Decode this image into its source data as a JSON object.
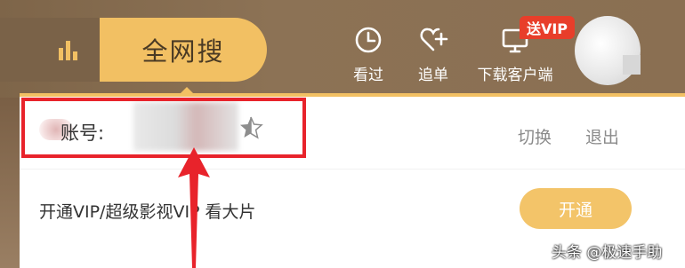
{
  "search": {
    "label": "全网搜"
  },
  "nav": {
    "history": "看过",
    "watchlist": "追单",
    "download": "下载客户端",
    "vip_badge": "送VIP"
  },
  "account": {
    "label": "账号:",
    "switch": "切换",
    "logout": "退出"
  },
  "promo": {
    "text": "开通VIP/超级影视VIP 看大片",
    "button": "开通"
  },
  "watermark": "头条 @极速手助",
  "colors": {
    "accent": "#f2c063",
    "highlight_box": "#e8232b",
    "vip_badge": "#e83e2a",
    "link_gray": "#8b8b8b"
  },
  "icons": [
    "bars-icon",
    "clock-icon",
    "heart-plus-icon",
    "monitor-icon",
    "star-icon",
    "arrow-up-icon"
  ]
}
